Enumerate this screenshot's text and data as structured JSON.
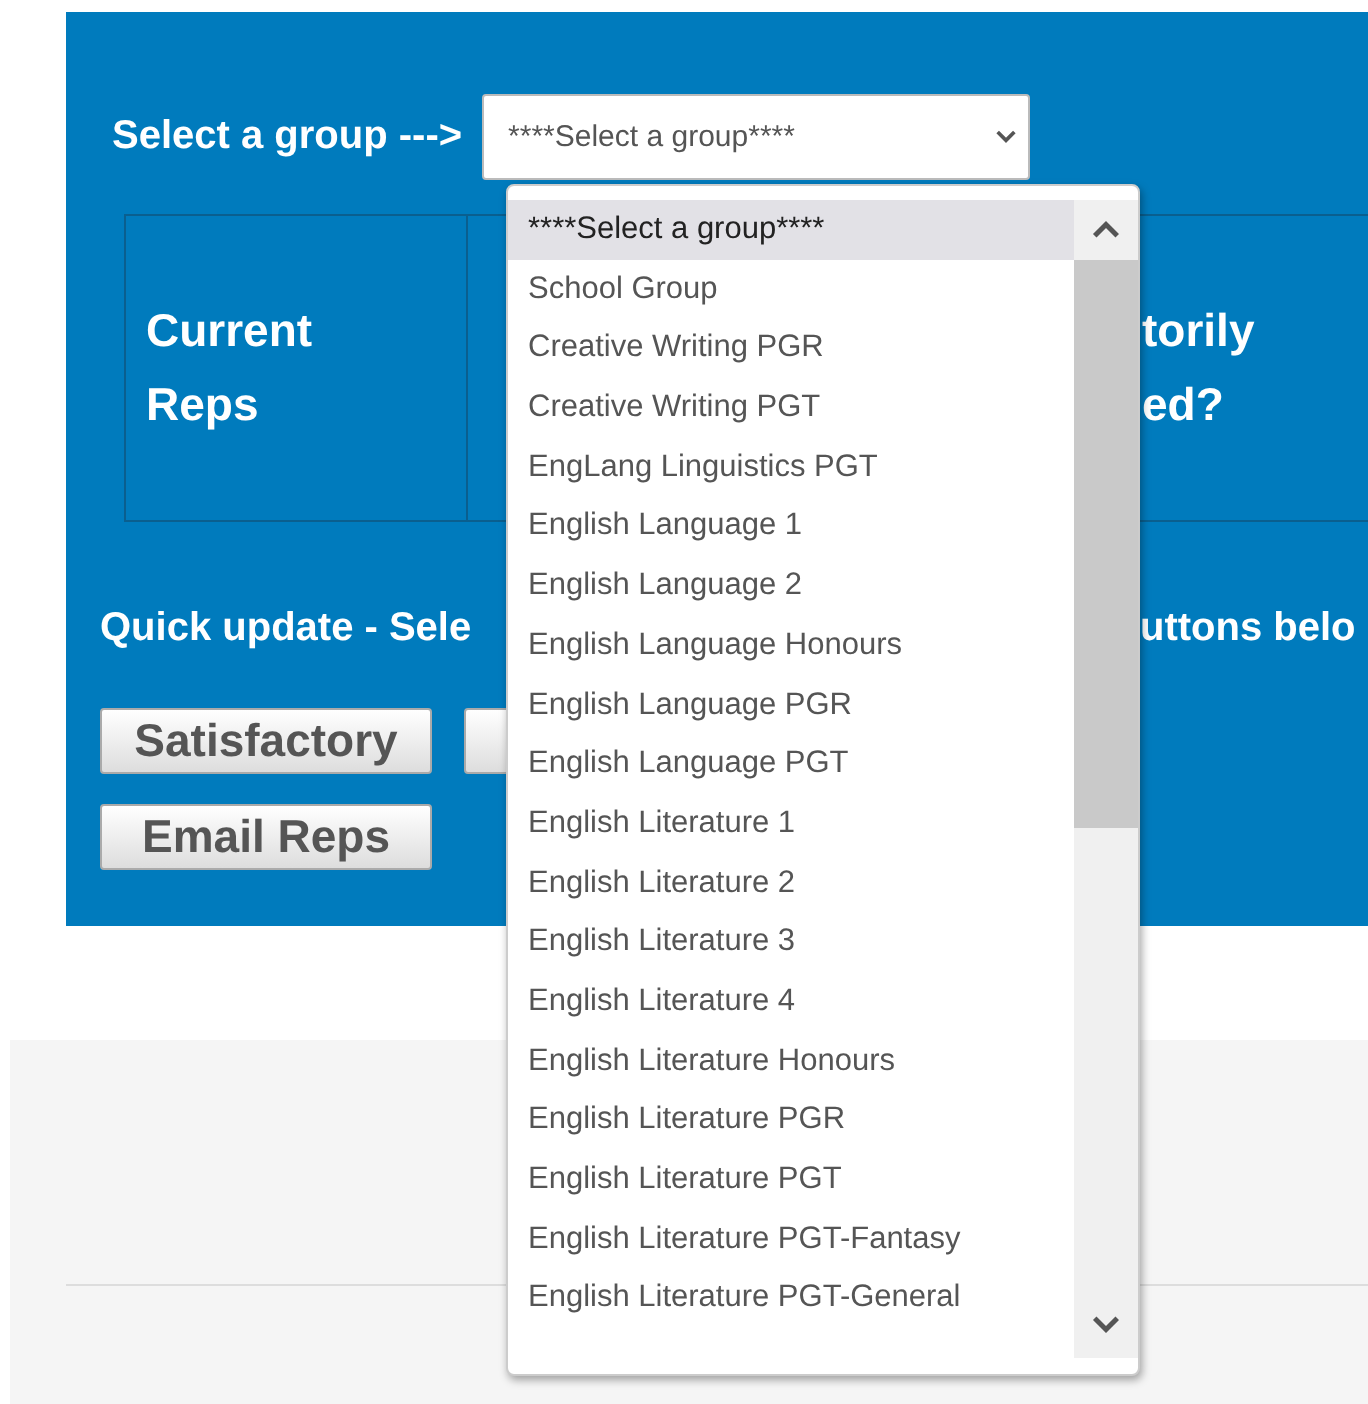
{
  "group_picker": {
    "label": "Select a group --->",
    "value": "****Select a group****",
    "expanded": true,
    "options": [
      {
        "label": "****Select a group****",
        "selected": true
      },
      {
        "label": "School Group",
        "selected": false
      },
      {
        "label": "Creative Writing PGR",
        "selected": false
      },
      {
        "label": "Creative Writing PGT",
        "selected": false
      },
      {
        "label": "EngLang Linguistics PGT",
        "selected": false
      },
      {
        "label": "English Language 1",
        "selected": false
      },
      {
        "label": "English Language 2",
        "selected": false
      },
      {
        "label": "English Language Honours",
        "selected": false
      },
      {
        "label": "English Language PGR",
        "selected": false
      },
      {
        "label": "English Language PGT",
        "selected": false
      },
      {
        "label": "English Literature 1",
        "selected": false
      },
      {
        "label": "English Literature 2",
        "selected": false
      },
      {
        "label": "English Literature 3",
        "selected": false
      },
      {
        "label": "English Literature 4",
        "selected": false
      },
      {
        "label": "English Literature Honours",
        "selected": false
      },
      {
        "label": "English Literature PGR",
        "selected": false
      },
      {
        "label": "English Literature PGT",
        "selected": false
      },
      {
        "label": "English Literature PGT-Fantasy",
        "selected": false
      },
      {
        "label": "English Literature PGT-General",
        "selected": false
      }
    ]
  },
  "reps_table": {
    "columns": [
      {
        "lines": [
          "Current",
          "Reps"
        ]
      },
      {
        "lines": [
          "torily",
          "ed?"
        ]
      }
    ]
  },
  "quick_update": {
    "text_before": "Quick update - Sele",
    "text_after": "uttons belo"
  },
  "buttons": [
    {
      "kind": "labeled",
      "label": "Satisfactory"
    },
    {
      "kind": "covered"
    },
    {
      "kind": "labeled",
      "label": "Email Reps"
    }
  ]
}
